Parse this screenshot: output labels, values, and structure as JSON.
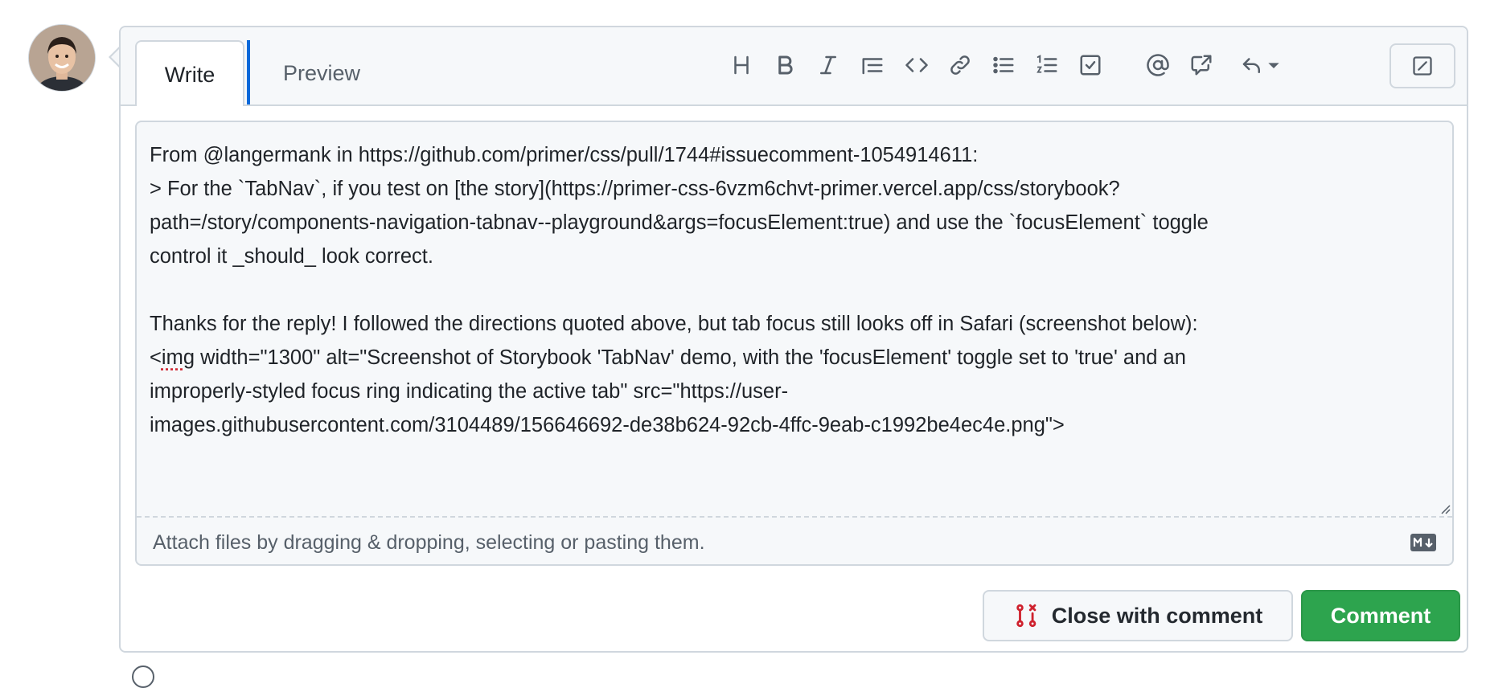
{
  "avatar": {
    "icon": "user-avatar"
  },
  "tabs": {
    "write_label": "Write",
    "preview_label": "Preview"
  },
  "toolbar": {
    "icons": [
      "heading-icon",
      "bold-icon",
      "italic-icon",
      "quote-icon",
      "code-icon",
      "link-icon",
      "unordered-list-icon",
      "ordered-list-icon",
      "task-list-icon",
      "mention-icon",
      "cross-reference-icon",
      "reply-icon",
      "fullscreen-icon"
    ]
  },
  "editor": {
    "lines": [
      "From @langermank in https://github.com/primer/css/pull/1744#issuecomment-1054914611:",
      "> For the `TabNav`, if you test on [the story](https://primer-css-6vzm6chvt-primer.vercel.app/css/storybook?",
      "path=/story/components-navigation-tabnav--playground&args=focusElement:true) and use the `focusElement` toggle",
      "control it _should_ look correct.",
      "",
      "Thanks for the reply! I followed the directions quoted above, but tab focus still looks off in Safari (screenshot below):",
      "<img width=\"1300\" alt=\"Screenshot of Storybook 'TabNav' demo, with the 'focusElement' toggle set to 'true' and an",
      "improperly-styled focus ring indicating the active tab\" src=\"https://user-",
      "images.githubusercontent.com/3104489/156646692-de38b624-92cb-4ffc-9eab-c1992be4ec4e.png\">"
    ],
    "line7_prefix": "<",
    "line7_misspelled": "img",
    "line7_rest": " width=\"1300\" alt=\"Screenshot of Storybook 'TabNav' demo, with the 'focusElement' toggle set to 'true' and an",
    "attach_text": "Attach files by dragging & dropping, selecting or pasting them.",
    "markdown_icon": "markdown-icon"
  },
  "actions": {
    "close_label": "Close with comment",
    "close_icon": "issue-closed-icon",
    "comment_label": "Comment"
  },
  "colors": {
    "accent_blue": "#0969da",
    "comment_green": "#2da44e",
    "close_icon_red": "#cf222e",
    "border": "#d0d7de",
    "muted": "#57606a"
  }
}
